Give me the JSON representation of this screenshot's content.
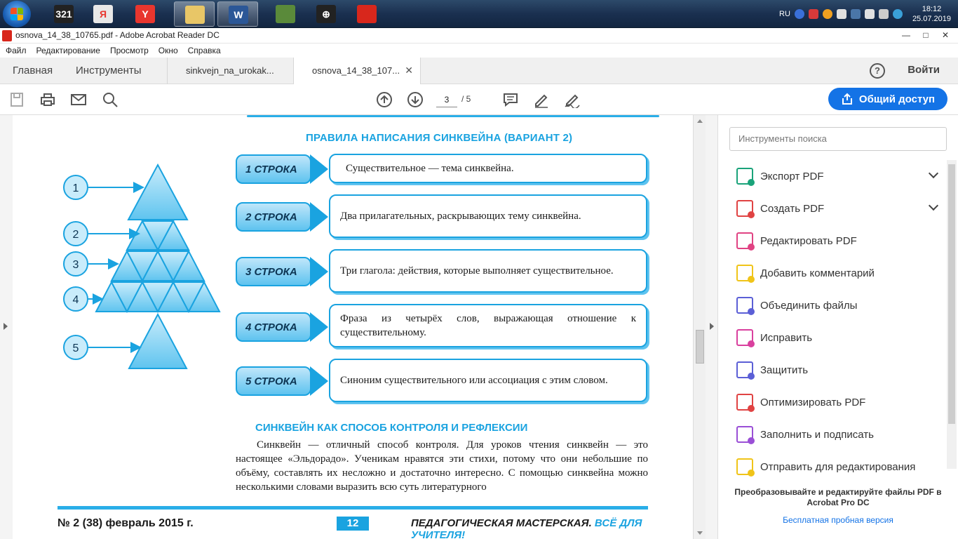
{
  "taskbar": {
    "apps": [
      {
        "name": "media-player-classic-icon",
        "label": "321",
        "color": "#222222"
      },
      {
        "name": "yandex-icon",
        "label": "Я",
        "color": "#e8e8e8"
      },
      {
        "name": "yandex-browser-icon",
        "label": "Y",
        "color": "#e8362e"
      },
      {
        "name": "file-explorer-icon",
        "label": "",
        "color": "#e8c667"
      },
      {
        "name": "word-icon",
        "label": "W",
        "color": "#2b5797"
      },
      {
        "name": "minecraft-icon",
        "label": "",
        "color": "#5a8a3a"
      },
      {
        "name": "crosshair-app-icon",
        "label": "⊕",
        "color": "#222222"
      },
      {
        "name": "acrobat-icon",
        "label": "",
        "color": "#d8271c"
      }
    ],
    "lang": "RU",
    "time": "18:12",
    "date": "25.07.2019"
  },
  "window": {
    "title": "osnova_14_38_10765.pdf - Adobe Acrobat Reader DC",
    "minimize": "—",
    "maximize": "□",
    "close": "✕"
  },
  "menu": [
    "Файл",
    "Редактирование",
    "Просмотр",
    "Окно",
    "Справка"
  ],
  "tabs": {
    "home": "Главная",
    "tools": "Инструменты",
    "doc1": "sinkvejn_na_urokak...",
    "doc2": "osnova_14_38_107...",
    "close": "✕",
    "help": "?",
    "signin": "Войти"
  },
  "toolbar": {
    "page_current": "3",
    "page_total": "/  5",
    "share": "Общий доступ"
  },
  "page": {
    "rules_title": "ПРАВИЛА НАПИСАНИЯ СИНКВЕЙНА (ВАРИАНТ 2)",
    "pyramid_labels": [
      "1",
      "2",
      "3",
      "4",
      "5"
    ],
    "rows": [
      {
        "label": "1 СТРОКА",
        "text": "Существительное — тема синквейна."
      },
      {
        "label": "2 СТРОКА",
        "text": "Два прилагательных, раскрывающих тему синквейна."
      },
      {
        "label": "3 СТРОКА",
        "text": "Три глагола: действия, которые выполняет существительное."
      },
      {
        "label": "4 СТРОКА",
        "text": "Фраза из четырёх слов, выражающая отношение к существительному."
      },
      {
        "label": "5 СТРОКА",
        "text": "Синоним существительного или ассоциация с этим словом."
      }
    ],
    "section_title": "СИНКВЕЙН КАК СПОСОБ КОНТРОЛЯ И РЕФЛЕКСИИ",
    "paragraph": "Синквейн — отличный способ контроля. Для уроков чтения синквейн — это настоящее «Эльдорадо». Ученикам нравятся эти стихи, потому что они небольшие по объёму, составлять их несложно и достаточно интересно. С помощью синквейна можно несколькими словами выразить всю суть литературного",
    "footer_left": "№ 2 (38) февраль 2015 г.",
    "footer_page": "12",
    "footer_right_a": "ПЕДАГОГИЧЕСКАЯ МАСТЕРСКАЯ. ",
    "footer_right_b": "ВСЁ ДЛЯ УЧИТЕЛЯ!"
  },
  "right_panel": {
    "search_placeholder": "Инструменты поиска",
    "tools": [
      {
        "name": "export-pdf",
        "label": "Экспорт PDF",
        "color": "#1aa37a",
        "expandable": true
      },
      {
        "name": "create-pdf",
        "label": "Создать PDF",
        "color": "#e04343",
        "expandable": true
      },
      {
        "name": "edit-pdf",
        "label": "Редактировать PDF",
        "color": "#e04383",
        "expandable": false
      },
      {
        "name": "add-comment",
        "label": "Добавить комментарий",
        "color": "#f0c419",
        "expandable": false
      },
      {
        "name": "combine-files",
        "label": "Объединить файлы",
        "color": "#5b5fd6",
        "expandable": false
      },
      {
        "name": "fix",
        "label": "Исправить",
        "color": "#d9409e",
        "expandable": false
      },
      {
        "name": "protect",
        "label": "Защитить",
        "color": "#5b5fd6",
        "expandable": false
      },
      {
        "name": "optimize-pdf",
        "label": "Оптимизировать PDF",
        "color": "#e04343",
        "expandable": false
      },
      {
        "name": "fill-sign",
        "label": "Заполнить и подписать",
        "color": "#9a4fd6",
        "expandable": false
      },
      {
        "name": "send-for-review",
        "label": "Отправить для редактирования",
        "color": "#f0c419",
        "expandable": false
      }
    ],
    "promo": "Преобразовывайте и редактируйте файлы PDF в Acrobat Pro DC",
    "trial": "Бесплатная пробная версия"
  }
}
